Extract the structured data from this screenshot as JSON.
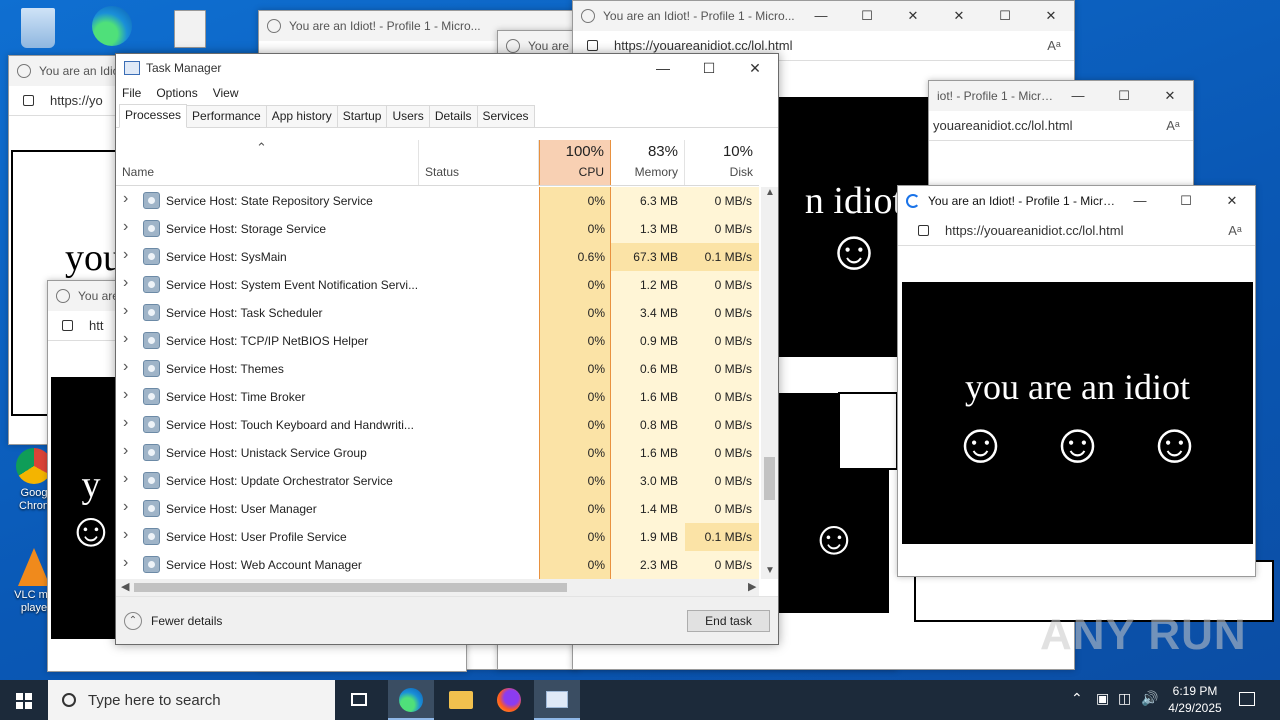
{
  "desktop": {
    "icons": [
      {
        "name": "recycle-bin-icon",
        "label": ""
      },
      {
        "name": "edge-desktop-icon",
        "label": ""
      },
      {
        "name": "file-desktop-icon",
        "label": ""
      },
      {
        "name": "chrome-desktop-icon",
        "label": "Goog Chron"
      },
      {
        "name": "vlc-desktop-icon",
        "label": "VLC me playe"
      }
    ]
  },
  "browser": {
    "title_full": "You are an Idiot! - Profile 1 - Micro...",
    "title_short": "You are an Idiot",
    "title_trunc_a": "You are a",
    "title_trunc_b": "You are",
    "title_tail": "iot! - Profile 1 - Micro...",
    "url": "https://youareanidiot.cc/lol.html",
    "url_partial_a": "https://yo",
    "url_partial_b": "htt",
    "url_tail": "youareanidiot.cc/lol.html",
    "read_aloud": "Aᵃ",
    "message": "you are an idiot",
    "message_partial_a": "you",
    "message_partial_b": "n idiot",
    "message_partial_c": "y",
    "smiley": "☺"
  },
  "task_manager": {
    "title": "Task Manager",
    "menu": [
      "File",
      "Options",
      "View"
    ],
    "tabs": [
      "Processes",
      "Performance",
      "App history",
      "Startup",
      "Users",
      "Details",
      "Services"
    ],
    "columns": {
      "name": "Name",
      "status": "Status",
      "cpu": {
        "percent": "100%",
        "label": "CPU"
      },
      "memory": {
        "percent": "83%",
        "label": "Memory"
      },
      "disk": {
        "percent": "10%",
        "label": "Disk"
      }
    },
    "rows": [
      {
        "name": "Service Host: State Repository Service",
        "cpu": "0%",
        "memory": "6.3 MB",
        "disk": "0 MB/s"
      },
      {
        "name": "Service Host: Storage Service",
        "cpu": "0%",
        "memory": "1.3 MB",
        "disk": "0 MB/s"
      },
      {
        "name": "Service Host: SysMain",
        "cpu": "0.6%",
        "memory": "67.3 MB",
        "disk": "0.1 MB/s"
      },
      {
        "name": "Service Host: System Event Notification Servi...",
        "cpu": "0%",
        "memory": "1.2 MB",
        "disk": "0 MB/s"
      },
      {
        "name": "Service Host: Task Scheduler",
        "cpu": "0%",
        "memory": "3.4 MB",
        "disk": "0 MB/s"
      },
      {
        "name": "Service Host: TCP/IP NetBIOS Helper",
        "cpu": "0%",
        "memory": "0.9 MB",
        "disk": "0 MB/s"
      },
      {
        "name": "Service Host: Themes",
        "cpu": "0%",
        "memory": "0.6 MB",
        "disk": "0 MB/s"
      },
      {
        "name": "Service Host: Time Broker",
        "cpu": "0%",
        "memory": "1.6 MB",
        "disk": "0 MB/s"
      },
      {
        "name": "Service Host: Touch Keyboard and Handwriti...",
        "cpu": "0%",
        "memory": "0.8 MB",
        "disk": "0 MB/s"
      },
      {
        "name": "Service Host: Unistack Service Group",
        "cpu": "0%",
        "memory": "1.6 MB",
        "disk": "0 MB/s"
      },
      {
        "name": "Service Host: Update Orchestrator Service",
        "cpu": "0%",
        "memory": "3.0 MB",
        "disk": "0 MB/s"
      },
      {
        "name": "Service Host: User Manager",
        "cpu": "0%",
        "memory": "1.4 MB",
        "disk": "0 MB/s"
      },
      {
        "name": "Service Host: User Profile Service",
        "cpu": "0%",
        "memory": "1.9 MB",
        "disk": "0.1 MB/s"
      },
      {
        "name": "Service Host: Web Account Manager",
        "cpu": "0%",
        "memory": "2.3 MB",
        "disk": "0 MB/s"
      }
    ],
    "fewer_details": "Fewer details",
    "end_task": "End task"
  },
  "taskbar": {
    "search_placeholder": "Type here to search",
    "time": "6:19 PM",
    "date": "4/29/2025"
  },
  "watermark": "ANY RUN",
  "colors": {
    "cpu_high": "#f8d0b3",
    "cpu_border": "#e8913f",
    "memory": "#fcefc7",
    "heat_light": "#fff5d6",
    "heat_mid": "#fbe3a6",
    "taskbar": "#1c2a3a",
    "desktop": "#0a64c8"
  }
}
